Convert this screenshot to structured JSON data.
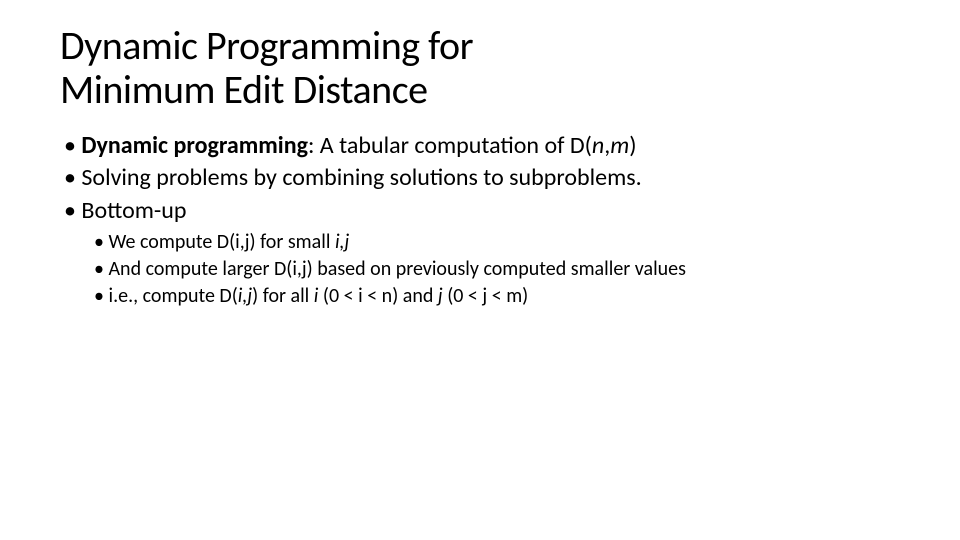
{
  "title_line1": "Dynamic Programming for",
  "title_line2": "Minimum Edit Distance",
  "b1_strong": "Dynamic programming",
  "b1_rest": ": A tabular computation of D(",
  "b1_n": "n",
  "b1_comma": ",",
  "b1_m": "m",
  "b1_close": ")",
  "b2": "Solving problems by combining solutions to subproblems.",
  "b3": "Bottom-up",
  "s1_a": "We compute D(i,j) for small ",
  "s1_b": "i,j",
  "s2": "And compute larger D(i,j) based on previously computed smaller values",
  "s3_a": "i.e., compute D(",
  "s3_b": "i,j",
  "s3_c": ") for all ",
  "s3_d": "i",
  "s3_e": " (0 < i < n)  and ",
  "s3_f": "j",
  "s3_g": " (0 < j < m)"
}
